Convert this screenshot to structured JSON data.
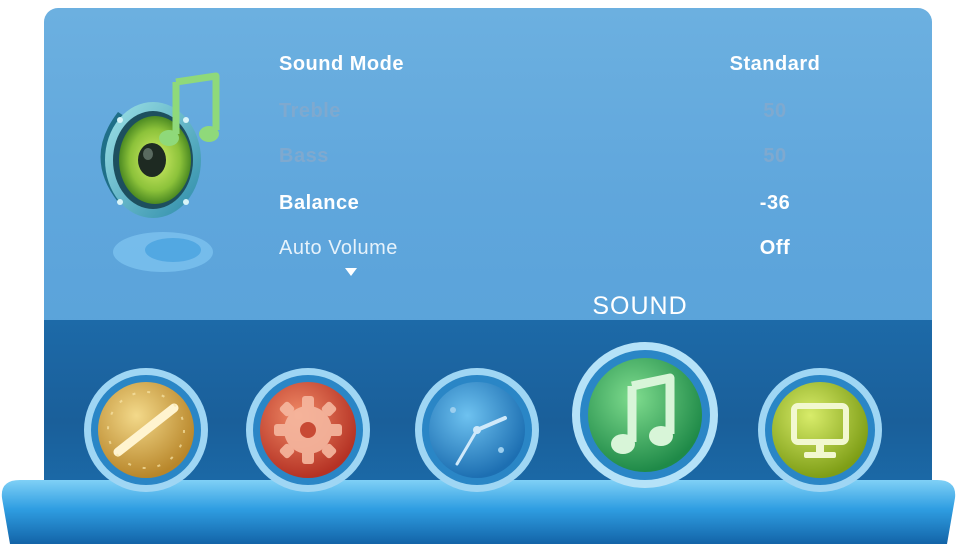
{
  "section_title": "SOUND",
  "menu_icon": "speaker-music-icon",
  "menu": {
    "items": [
      {
        "label": "Sound Mode",
        "value": "Standard",
        "state": "normal"
      },
      {
        "label": "Treble",
        "value": "50",
        "state": "disabled"
      },
      {
        "label": "Bass",
        "value": "50",
        "state": "disabled"
      },
      {
        "label": "Balance",
        "value": "-36",
        "state": "selected"
      },
      {
        "label": "Auto Volume",
        "value": "Off",
        "state": "normal"
      }
    ],
    "more_indicator": "scroll-down-arrow-icon"
  },
  "tabs": [
    {
      "icon": "dial-icon",
      "color": "#d9b24a",
      "active": false
    },
    {
      "icon": "gear-icon",
      "color": "#e0553f",
      "active": false
    },
    {
      "icon": "clock-icon",
      "color": "#2f8fd2",
      "active": false
    },
    {
      "icon": "music-note-icon",
      "color": "#3aa760",
      "active": true
    },
    {
      "icon": "monitor-icon",
      "color": "#a7c22a",
      "active": false
    }
  ],
  "colors": {
    "panel": "#5fa6dc",
    "tray": "#1a5f9a",
    "text": "#ffffff",
    "disabled_text": "#7fa9cf"
  }
}
